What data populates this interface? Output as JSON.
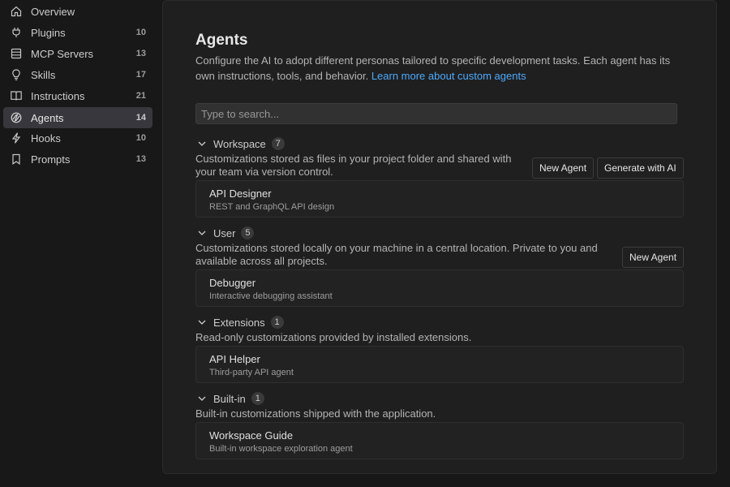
{
  "sidebar": {
    "items": [
      {
        "label": "Overview",
        "count": "",
        "icon": "home-icon"
      },
      {
        "label": "Plugins",
        "count": "10",
        "icon": "plug-icon"
      },
      {
        "label": "MCP Servers",
        "count": "13",
        "icon": "server-icon"
      },
      {
        "label": "Skills",
        "count": "17",
        "icon": "lightbulb-icon"
      },
      {
        "label": "Instructions",
        "count": "21",
        "icon": "book-icon"
      },
      {
        "label": "Agents",
        "count": "14",
        "icon": "agent-icon",
        "active": true
      },
      {
        "label": "Hooks",
        "count": "10",
        "icon": "lightning-icon"
      },
      {
        "label": "Prompts",
        "count": "13",
        "icon": "bookmark-icon"
      }
    ]
  },
  "main": {
    "title": "Agents",
    "description": "Configure the AI to adopt different personas tailored to specific development tasks. Each agent has its own instructions, tools, and behavior.",
    "learn_more": "Learn more about custom agents",
    "search_placeholder": "Type to search..."
  },
  "sections": {
    "workspace": {
      "name": "Workspace",
      "count": "7",
      "description": "Customizations stored as files in your project folder and shared with your team via version control.",
      "new_agent_label": "New Agent",
      "generate_label": "Generate with AI",
      "items": [
        {
          "title": "API Designer",
          "subtitle": "REST and GraphQL API design"
        }
      ]
    },
    "user": {
      "name": "User",
      "count": "5",
      "description": "Customizations stored locally on your machine in a central location. Private to you and available across all projects.",
      "new_agent_label": "New Agent",
      "items": [
        {
          "title": "Debugger",
          "subtitle": "Interactive debugging assistant"
        }
      ]
    },
    "extensions": {
      "name": "Extensions",
      "count": "1",
      "description": "Read-only customizations provided by installed extensions.",
      "items": [
        {
          "title": "API Helper",
          "subtitle": "Third-party API agent"
        }
      ]
    },
    "builtin": {
      "name": "Built-in",
      "count": "1",
      "description": "Built-in customizations shipped with the application.",
      "items": [
        {
          "title": "Workspace Guide",
          "subtitle": "Built-in workspace exploration agent"
        }
      ]
    }
  },
  "colors": {
    "background": "#181818",
    "panel": "#1f1f1f",
    "active_item": "#37373d",
    "link": "#4daafc"
  }
}
